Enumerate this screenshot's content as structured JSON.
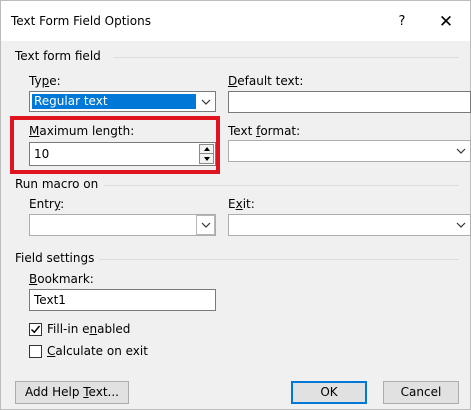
{
  "window": {
    "title": "Text Form Field Options",
    "help_label": "?",
    "close_label": "✕"
  },
  "text_form_field": {
    "section_label": "Text form field",
    "type_label_pre": "Ty",
    "type_label_ul": "p",
    "type_label_post": "e:",
    "type_value": "Regular text",
    "default_text_label_pre": "",
    "default_text_label_ul": "D",
    "default_text_label_post": "efault text:",
    "default_text_value": "",
    "max_length_label_pre": "",
    "max_length_label_ul": "M",
    "max_length_label_post": "aximum length:",
    "max_length_value": "10",
    "text_format_label_pre": "Text ",
    "text_format_label_ul": "f",
    "text_format_label_post": "ormat:",
    "text_format_value": ""
  },
  "run_macro": {
    "section_label": "Run macro on",
    "entry_label_pre": "Entr",
    "entry_label_ul": "y",
    "entry_label_post": ":",
    "entry_value": "",
    "exit_label_pre": "E",
    "exit_label_ul": "x",
    "exit_label_post": "it:",
    "exit_value": ""
  },
  "field_settings": {
    "section_label": "Field settings",
    "bookmark_label_pre": "",
    "bookmark_label_ul": "B",
    "bookmark_label_post": "ookmark:",
    "bookmark_value": "Text1",
    "fill_in_label_pre": "Fill-in e",
    "fill_in_label_ul": "n",
    "fill_in_label_post": "abled",
    "fill_in_checked": true,
    "calculate_label_pre": "",
    "calculate_label_ul": "C",
    "calculate_label_post": "alculate on exit",
    "calculate_checked": false
  },
  "buttons": {
    "add_help_pre": "Add Help ",
    "add_help_ul": "T",
    "add_help_post": "ext...",
    "ok": "OK",
    "cancel": "Cancel"
  },
  "colors": {
    "highlight_frame": "#e0141e",
    "selection": "#0078d7"
  }
}
